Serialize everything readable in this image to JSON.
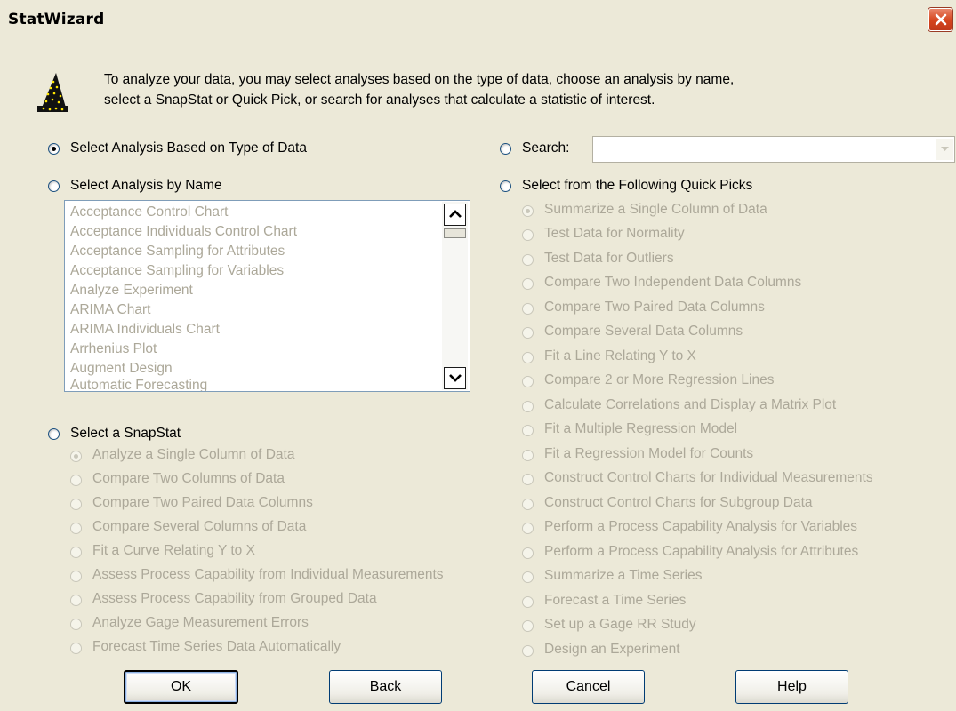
{
  "window": {
    "title": "StatWizard"
  },
  "intro": {
    "line1": "To analyze your data, you may select analyses based on the type of data, choose an analysis by name,",
    "line2": "select a SnapStat or Quick Pick, or search for analyses that calculate a statistic of interest."
  },
  "options": {
    "type_of_data": "Select Analysis Based on Type of Data",
    "by_name": "Select Analysis by Name",
    "snapstat": "Select a SnapStat",
    "search": "Search:",
    "quick_picks": "Select from the Following Quick Picks"
  },
  "search": {
    "value": ""
  },
  "analysis_list": [
    "Acceptance Control Chart",
    "Acceptance Individuals Control Chart",
    "Acceptance Sampling for Attributes",
    "Acceptance Sampling for Variables",
    "Analyze Experiment",
    "ARIMA Chart",
    "ARIMA Individuals Chart",
    "Arrhenius Plot",
    "Augment Design",
    "Automatic Forecasting"
  ],
  "snapstats": [
    "Analyze a Single Column of Data",
    "Compare Two Columns of Data",
    "Compare Two Paired Data Columns",
    "Compare Several Columns of Data",
    "Fit a Curve Relating Y to X",
    "Assess Process Capability from Individual Measurements",
    "Assess Process Capability from Grouped Data",
    "Analyze Gage Measurement Errors",
    "Forecast Time Series Data Automatically"
  ],
  "quick_picks": [
    "Summarize a Single Column of Data",
    "Test Data for Normality",
    "Test Data for Outliers",
    "Compare Two Independent Data Columns",
    "Compare Two Paired Data Columns",
    "Compare Several Data Columns",
    "Fit a Line Relating Y to X",
    "Compare 2 or More Regression Lines",
    "Calculate Correlations and Display a Matrix Plot",
    "Fit a Multiple Regression Model",
    "Fit a Regression Model for Counts",
    "Construct Control Charts for Individual Measurements",
    "Construct Control Charts for Subgroup Data",
    "Perform a Process Capability Analysis for Variables",
    "Perform a Process Capability Analysis for Attributes",
    "Summarize a Time Series",
    "Forecast a Time Series",
    "Set up a Gage RR Study",
    "Design an Experiment"
  ],
  "buttons": {
    "ok": "OK",
    "back": "Back",
    "cancel": "Cancel",
    "help": "Help"
  },
  "colors": {
    "dialog_bg": "#ece9d8",
    "disabled_text": "#aca899",
    "close_button": "#d5451d"
  },
  "icons": {
    "wizard": "wizard-hat-icon",
    "close": "close-icon"
  }
}
